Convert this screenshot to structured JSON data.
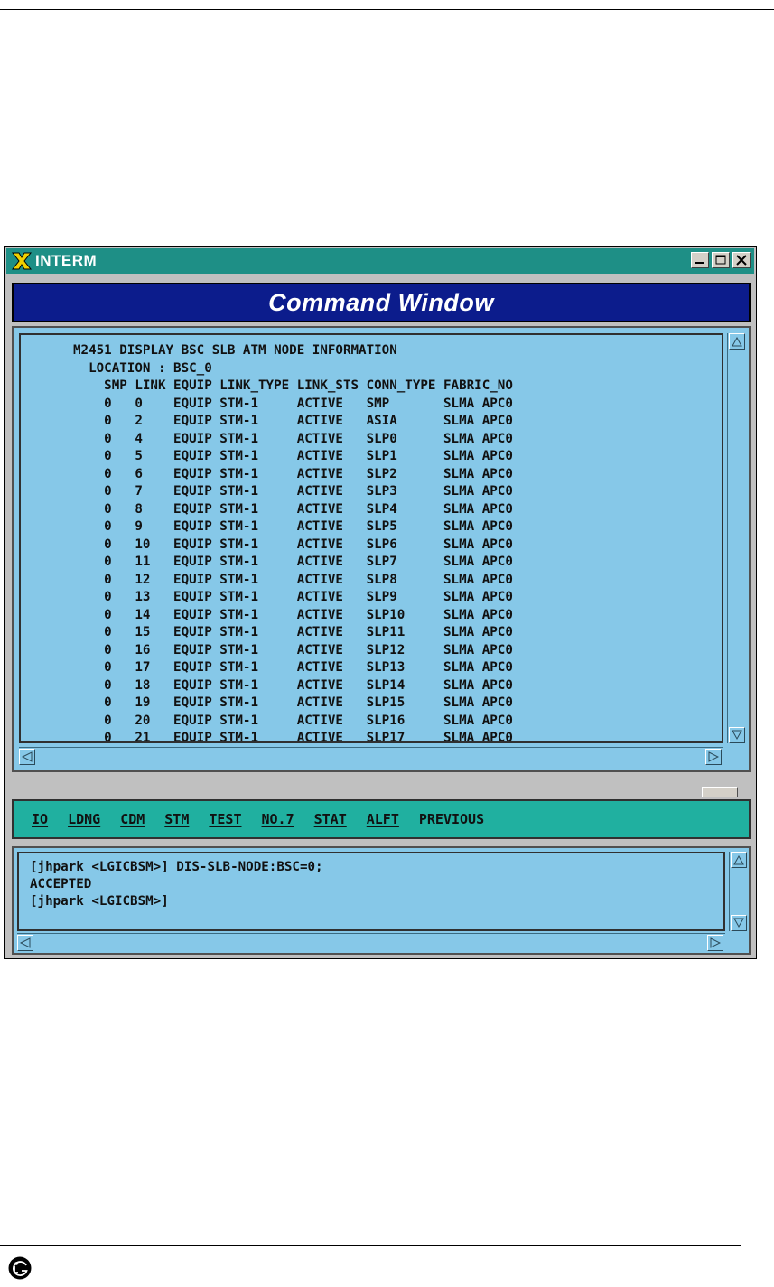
{
  "window": {
    "title": "INTERM"
  },
  "header": {
    "title": "Command Window"
  },
  "output": {
    "lines": [
      "M2451 DISPLAY BSC SLB ATM NODE INFORMATION",
      "  LOCATION : BSC_0",
      "    SMP LINK EQUIP LINK_TYPE LINK_STS CONN_TYPE FABRIC_NO",
      "    0   0    EQUIP STM-1     ACTIVE   SMP       SLMA APC0",
      "    0   2    EQUIP STM-1     ACTIVE   ASIA      SLMA APC0",
      "    0   4    EQUIP STM-1     ACTIVE   SLP0      SLMA APC0",
      "    0   5    EQUIP STM-1     ACTIVE   SLP1      SLMA APC0",
      "    0   6    EQUIP STM-1     ACTIVE   SLP2      SLMA APC0",
      "    0   7    EQUIP STM-1     ACTIVE   SLP3      SLMA APC0",
      "    0   8    EQUIP STM-1     ACTIVE   SLP4      SLMA APC0",
      "    0   9    EQUIP STM-1     ACTIVE   SLP5      SLMA APC0",
      "    0   10   EQUIP STM-1     ACTIVE   SLP6      SLMA APC0",
      "    0   11   EQUIP STM-1     ACTIVE   SLP7      SLMA APC0",
      "    0   12   EQUIP STM-1     ACTIVE   SLP8      SLMA APC0",
      "    0   13   EQUIP STM-1     ACTIVE   SLP9      SLMA APC0",
      "    0   14   EQUIP STM-1     ACTIVE   SLP10     SLMA APC0",
      "    0   15   EQUIP STM-1     ACTIVE   SLP11     SLMA APC0",
      "    0   16   EQUIP STM-1     ACTIVE   SLP12     SLMA APC0",
      "    0   17   EQUIP STM-1     ACTIVE   SLP13     SLMA APC0",
      "    0   18   EQUIP STM-1     ACTIVE   SLP14     SLMA APC0",
      "    0   19   EQUIP STM-1     ACTIVE   SLP15     SLMA APC0",
      "    0   20   EQUIP STM-1     ACTIVE   SLP16     SLMA APC0",
      "    0   21   EQUIP STM-1     ACTIVE   SLP17     SLMA APC0"
    ]
  },
  "menu": {
    "items": [
      "IO",
      "LDNG",
      "CDM",
      "STM",
      "TEST",
      "NO.7",
      "STAT",
      "ALFT",
      "PREVIOUS"
    ]
  },
  "console": {
    "lines": [
      "[jhpark <LGICBSM>] DIS-SLB-NODE:BSC=0;",
      "ACCEPTED",
      "[jhpark <LGICBSM>]"
    ]
  },
  "colors": {
    "titlebar": "#1e8f86",
    "header": "#0c1c8c",
    "panel": "#86c8e8",
    "menubar": "#20b0a0"
  }
}
